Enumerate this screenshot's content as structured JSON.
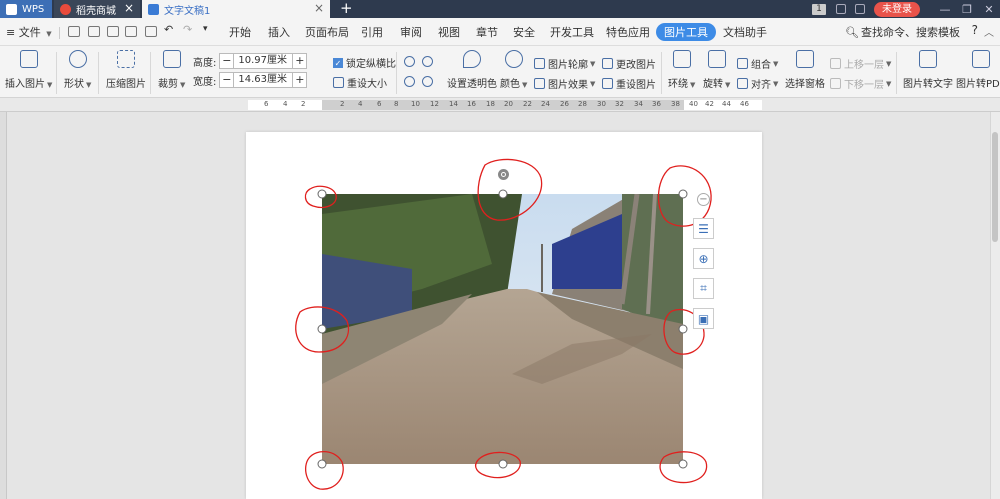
{
  "titlebar": {
    "tabs": [
      {
        "label": "WPS"
      },
      {
        "label": "稻壳商城"
      },
      {
        "label": "文字文稿1"
      }
    ],
    "page_count_badge": "1",
    "login_label": "未登录",
    "close_glyph": "×",
    "new_tab_glyph": "+"
  },
  "menubar": {
    "file_label": "文件",
    "items": [
      "开始",
      "插入",
      "页面布局",
      "引用",
      "审阅",
      "视图",
      "章节",
      "安全",
      "开发工具",
      "特色应用",
      "图片工具",
      "文档助手"
    ],
    "active_item": "图片工具",
    "search_label": "查找命令、搜索模板",
    "help_label": "?"
  },
  "ribbon": {
    "insert_picture": "插入图片",
    "shape": "形状",
    "compress_picture": "压缩图片",
    "crop": "裁剪",
    "height_label": "高度:",
    "height_value": "10.97厘米",
    "width_label": "宽度:",
    "width_value": "14.63厘米",
    "lock_ratio": "锁定纵横比",
    "reset_size": "重设大小",
    "set_transparent": "设置透明色",
    "color": "颜色",
    "picture_outline": "图片轮廓",
    "picture_effect": "图片效果",
    "change_picture": "更改图片",
    "reset_picture": "重设图片",
    "wrap": "环绕",
    "rotate": "旋转",
    "group": "组合",
    "align": "对齐",
    "selection_pane": "选择窗格",
    "bring_forward": "上移一层",
    "send_backward": "下移一层",
    "picture_to_text": "图片转文字",
    "picture_to_pdf": "图片转PDF",
    "minus": "−",
    "plus": "+"
  },
  "ruler": {
    "numbers": [
      "6",
      "4",
      "2",
      "2",
      "4",
      "6",
      "8",
      "10",
      "12",
      "14",
      "16",
      "18",
      "20",
      "22",
      "24",
      "26",
      "28",
      "30",
      "32",
      "34",
      "36",
      "38",
      "40",
      "42",
      "44",
      "46"
    ]
  },
  "side_tools": {
    "collapse": "−"
  },
  "colors": {
    "accent": "#3d8be6",
    "titlebar": "#2e3a4e",
    "annotation": "#e0201e"
  },
  "icons": [
    "menu-icon",
    "open-icon",
    "save-icon",
    "print-icon",
    "preview-icon",
    "undo-icon",
    "redo-icon",
    "search-icon",
    "layout-options-icon",
    "zoom-in-icon",
    "crop-icon",
    "picture-settings-icon",
    "rotate-handle-icon"
  ]
}
